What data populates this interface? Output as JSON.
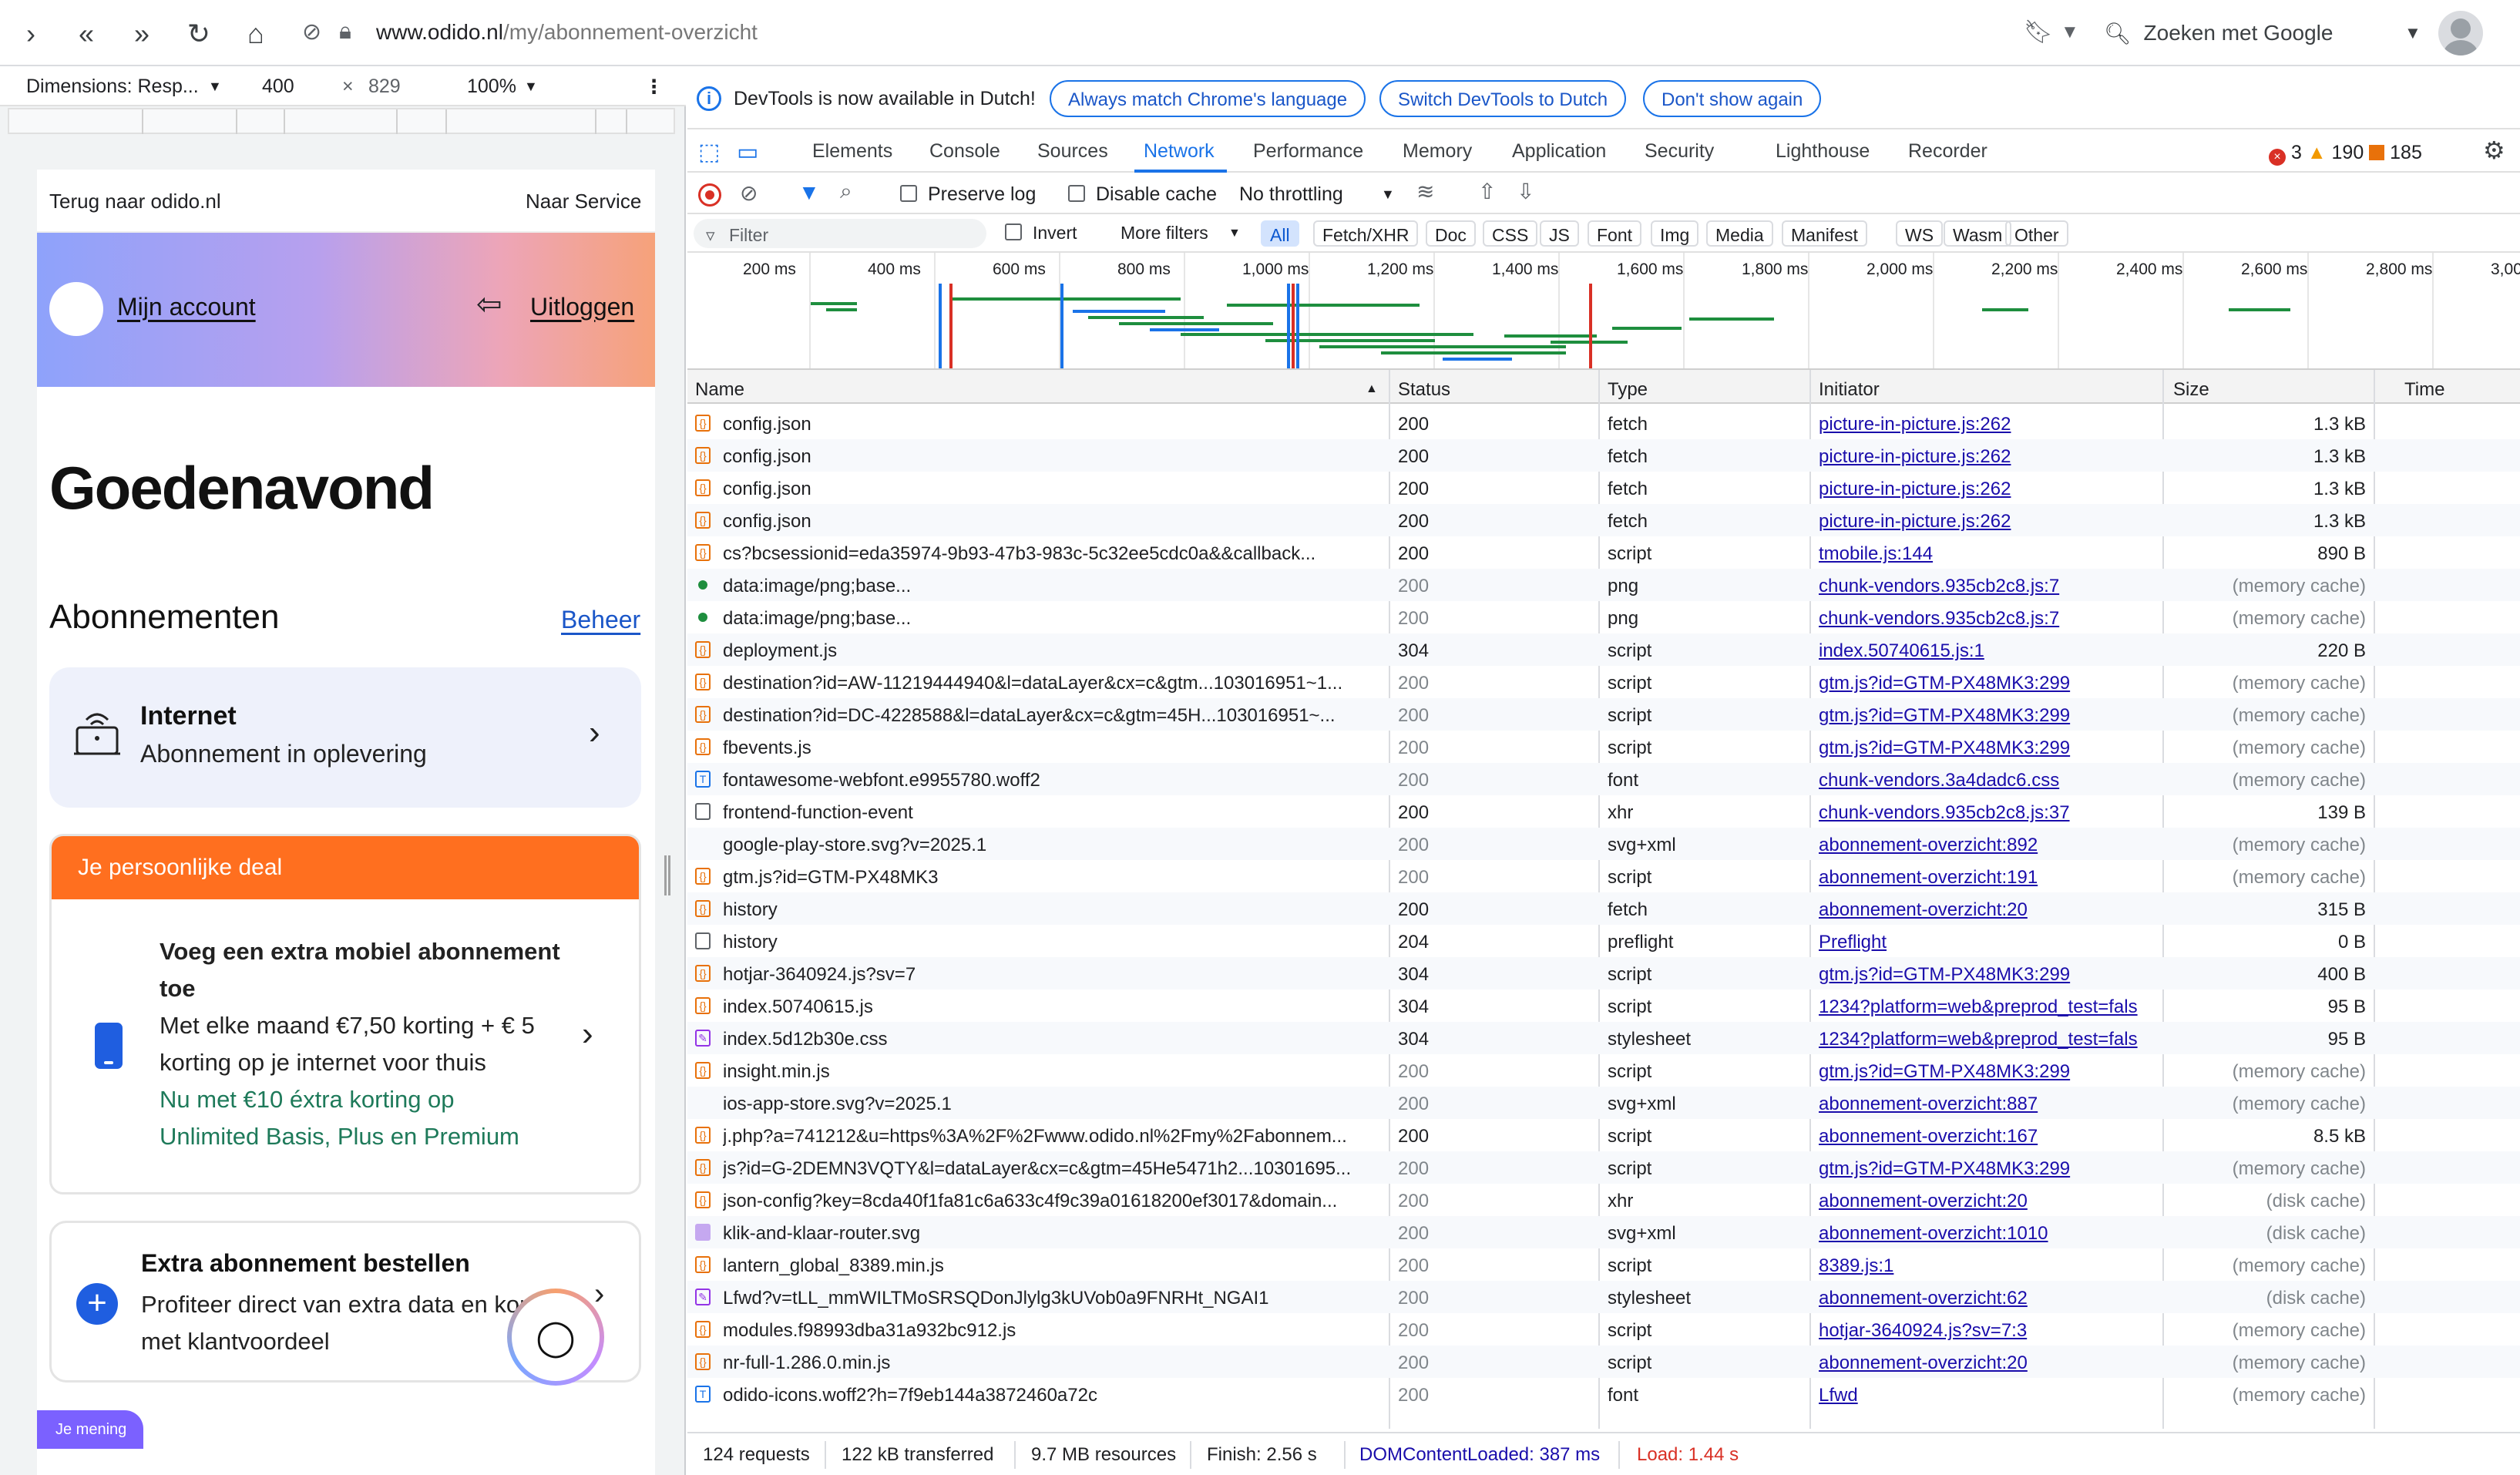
{
  "browser": {
    "url_host": "www.odido.nl",
    "url_path": "/my/abonnement-overzicht",
    "search_placeholder": "Zoeken met Google"
  },
  "device_toolbar": {
    "dimensions_label": "Dimensions: Resp...",
    "width": "400",
    "height": "829",
    "zoom": "100%"
  },
  "page": {
    "back_link": "Terug naar odido.nl",
    "service_link": "Naar Service",
    "account_link": "Mijn account",
    "logout_link": "Uitloggen",
    "greeting": "Goedenavond",
    "subscriptions_title": "Abonnementen",
    "manage_link": "Beheer",
    "internet_title": "Internet",
    "internet_sub": "Abonnement in oplevering",
    "deal_header": "Je persoonlijke deal",
    "deal_title": "Voeg een extra mobiel abonnement toe",
    "deal_text": "Met elke maand €7,50 korting + € 5 korting op je internet voor thuis",
    "deal_highlight": "Nu met €10 éxtra korting op Unlimited Basis, Plus en Premium",
    "extra_title": "Extra abonnement bestellen",
    "extra_sub": "Profiteer direct van extra data en korting met klantvoordeel",
    "feedback_tab": "Je mening"
  },
  "devtools": {
    "info_message": "DevTools is now available in Dutch!",
    "info_buttons": [
      "Always match Chrome's language",
      "Switch DevTools to Dutch",
      "Don't show again"
    ],
    "tabs": [
      "Elements",
      "Console",
      "Sources",
      "Network",
      "Performance",
      "Memory",
      "Application",
      "Security",
      "Lighthouse",
      "Recorder"
    ],
    "active_tab": "Network",
    "errors": "3",
    "warnings": "190",
    "issues": "185",
    "preserve_log": "Preserve log",
    "disable_cache": "Disable cache",
    "throttling": "No throttling",
    "filter_placeholder": "Filter",
    "invert": "Invert",
    "more_filters": "More filters",
    "type_filters": [
      "All",
      "Fetch/XHR",
      "Doc",
      "CSS",
      "JS",
      "Font",
      "Img",
      "Media",
      "Manifest",
      "WS",
      "Wasm",
      "Other"
    ],
    "overview_ticks": [
      "200 ms",
      "400 ms",
      "600 ms",
      "800 ms",
      "1,000 ms",
      "1,200 ms",
      "1,400 ms",
      "1,600 ms",
      "1,800 ms",
      "2,000 ms",
      "2,200 ms",
      "2,400 ms",
      "2,600 ms",
      "2,800 ms",
      "3,00"
    ],
    "columns": {
      "name": "Name",
      "status": "Status",
      "type": "Type",
      "initiator": "Initiator",
      "size": "Size",
      "time": "Time"
    },
    "requests": [
      {
        "name": "config.json",
        "status": "200",
        "type": "fetch",
        "initiator": "picture-in-picture.js:262",
        "size": "1.3 kB",
        "icon": "fetch",
        "dim": false
      },
      {
        "name": "config.json",
        "status": "200",
        "type": "fetch",
        "initiator": "picture-in-picture.js:262",
        "size": "1.3 kB",
        "icon": "fetch",
        "dim": false
      },
      {
        "name": "config.json",
        "status": "200",
        "type": "fetch",
        "initiator": "picture-in-picture.js:262",
        "size": "1.3 kB",
        "icon": "fetch",
        "dim": false
      },
      {
        "name": "config.json",
        "status": "200",
        "type": "fetch",
        "initiator": "picture-in-picture.js:262",
        "size": "1.3 kB",
        "icon": "fetch",
        "dim": false
      },
      {
        "name": "cs?bcsessionid=eda35974-9b93-47b3-983c-5c32ee5cdc0a&&callback...",
        "status": "200",
        "type": "script",
        "initiator": "tmobile.js:144",
        "size": "890 B",
        "icon": "js",
        "dim": false
      },
      {
        "name": "data:image/png;base...",
        "status": "200",
        "type": "png",
        "initiator": "chunk-vendors.935cb2c8.js:7",
        "size": "(memory cache)",
        "icon": "dot",
        "dim": true
      },
      {
        "name": "data:image/png;base...",
        "status": "200",
        "type": "png",
        "initiator": "chunk-vendors.935cb2c8.js:7",
        "size": "(memory cache)",
        "icon": "dot",
        "dim": true
      },
      {
        "name": "deployment.js",
        "status": "304",
        "type": "script",
        "initiator": "index.50740615.js:1",
        "size": "220 B",
        "icon": "js",
        "dim": false
      },
      {
        "name": "destination?id=AW-11219444940&l=dataLayer&cx=c&gtm...103016951~1...",
        "status": "200",
        "type": "script",
        "initiator": "gtm.js?id=GTM-PX48MK3:299",
        "size": "(memory cache)",
        "icon": "js",
        "dim": true
      },
      {
        "name": "destination?id=DC-4228588&l=dataLayer&cx=c&gtm=45H...103016951~...",
        "status": "200",
        "type": "script",
        "initiator": "gtm.js?id=GTM-PX48MK3:299",
        "size": "(memory cache)",
        "icon": "js",
        "dim": true
      },
      {
        "name": "fbevents.js",
        "status": "200",
        "type": "script",
        "initiator": "gtm.js?id=GTM-PX48MK3:299",
        "size": "(memory cache)",
        "icon": "js",
        "dim": true
      },
      {
        "name": "fontawesome-webfont.e9955780.woff2",
        "status": "200",
        "type": "font",
        "initiator": "chunk-vendors.3a4dadc6.css",
        "size": "(memory cache)",
        "icon": "font",
        "dim": true
      },
      {
        "name": "frontend-function-event",
        "status": "200",
        "type": "xhr",
        "initiator": "chunk-vendors.935cb2c8.js:37",
        "size": "139 B",
        "icon": "doc",
        "dim": false
      },
      {
        "name": "google-play-store.svg?v=2025.1",
        "status": "200",
        "type": "svg+xml",
        "initiator": "abonnement-overzicht:892",
        "size": "(memory cache)",
        "icon": "none",
        "dim": true
      },
      {
        "name": "gtm.js?id=GTM-PX48MK3",
        "status": "200",
        "type": "script",
        "initiator": "abonnement-overzicht:191",
        "size": "(memory cache)",
        "icon": "js",
        "dim": true
      },
      {
        "name": "history",
        "status": "200",
        "type": "fetch",
        "initiator": "abonnement-overzicht:20",
        "size": "315 B",
        "icon": "fetch",
        "dim": false
      },
      {
        "name": "history",
        "status": "204",
        "type": "preflight",
        "initiator": "Preflight",
        "size": "0 B",
        "icon": "doc",
        "dim": false
      },
      {
        "name": "hotjar-3640924.js?sv=7",
        "status": "304",
        "type": "script",
        "initiator": "gtm.js?id=GTM-PX48MK3:299",
        "size": "400 B",
        "icon": "js",
        "dim": false
      },
      {
        "name": "index.50740615.js",
        "status": "304",
        "type": "script",
        "initiator": "1234?platform=web&preprod_test=fals",
        "size": "95 B",
        "icon": "js",
        "dim": false
      },
      {
        "name": "index.5d12b30e.css",
        "status": "304",
        "type": "stylesheet",
        "initiator": "1234?platform=web&preprod_test=fals",
        "size": "95 B",
        "icon": "css",
        "dim": false
      },
      {
        "name": "insight.min.js",
        "status": "200",
        "type": "script",
        "initiator": "gtm.js?id=GTM-PX48MK3:299",
        "size": "(memory cache)",
        "icon": "js",
        "dim": true
      },
      {
        "name": "ios-app-store.svg?v=2025.1",
        "status": "200",
        "type": "svg+xml",
        "initiator": "abonnement-overzicht:887",
        "size": "(memory cache)",
        "icon": "none",
        "dim": true
      },
      {
        "name": "j.php?a=741212&u=https%3A%2F%2Fwww.odido.nl%2Fmy%2Fabonnem...",
        "status": "200",
        "type": "script",
        "initiator": "abonnement-overzicht:167",
        "size": "8.5 kB",
        "icon": "js",
        "dim": false
      },
      {
        "name": "js?id=G-2DEMN3VQTY&l=dataLayer&cx=c&gtm=45He5471h2...10301695...",
        "status": "200",
        "type": "script",
        "initiator": "gtm.js?id=GTM-PX48MK3:299",
        "size": "(memory cache)",
        "icon": "js",
        "dim": true
      },
      {
        "name": "json-config?key=8cda40f1fa81c6a633c4f9c39a01618200ef3017&domain...",
        "status": "200",
        "type": "xhr",
        "initiator": "abonnement-overzicht:20",
        "size": "(disk cache)",
        "icon": "js",
        "dim": true
      },
      {
        "name": "klik-and-klaar-router.svg",
        "status": "200",
        "type": "svg+xml",
        "initiator": "abonnement-overzicht:1010",
        "size": "(disk cache)",
        "icon": "img",
        "dim": true
      },
      {
        "name": "lantern_global_8389.min.js",
        "status": "200",
        "type": "script",
        "initiator": "8389.js:1",
        "size": "(memory cache)",
        "icon": "js",
        "dim": true
      },
      {
        "name": "Lfwd?v=tLL_mmWILTMoSRSQDonJlylg3kUVob0a9FNRHt_NGAI1",
        "status": "200",
        "type": "stylesheet",
        "initiator": "abonnement-overzicht:62",
        "size": "(disk cache)",
        "icon": "css",
        "dim": true
      },
      {
        "name": "modules.f98993dba31a932bc912.js",
        "status": "200",
        "type": "script",
        "initiator": "hotjar-3640924.js?sv=7:3",
        "size": "(memory cache)",
        "icon": "js",
        "dim": true
      },
      {
        "name": "nr-full-1.286.0.min.js",
        "status": "200",
        "type": "script",
        "initiator": "abonnement-overzicht:20",
        "size": "(memory cache)",
        "icon": "js",
        "dim": true
      },
      {
        "name": "odido-icons.woff2?h=7f9eb144a3872460a72c",
        "status": "200",
        "type": "font",
        "initiator": "Lfwd",
        "size": "(memory cache)",
        "icon": "font",
        "dim": true
      }
    ],
    "summary": {
      "requests": "124 requests",
      "transferred": "122 kB transferred",
      "resources": "9.7 MB resources",
      "finish": "Finish: 2.56 s",
      "dom_loaded": "DOMContentLoaded: 387 ms",
      "load": "Load: 1.44 s"
    }
  }
}
